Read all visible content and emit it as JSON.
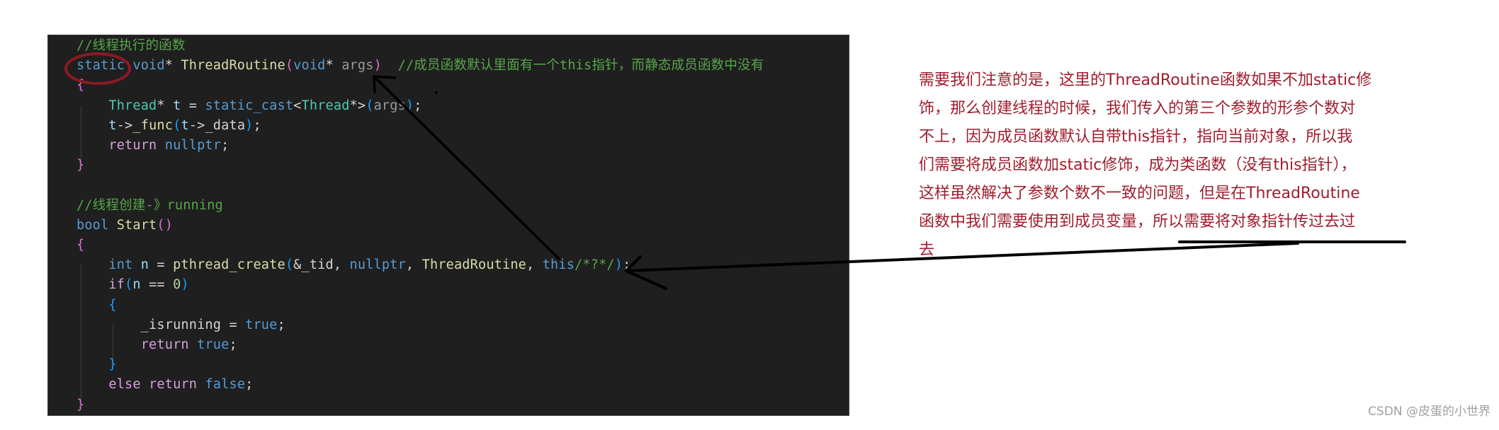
{
  "code": {
    "lines": [
      {
        "tokens": [
          {
            "t": "//线程执行的函数",
            "c": "c-comment"
          }
        ]
      },
      {
        "tokens": [
          {
            "t": "static",
            "c": "c-kw"
          },
          {
            "t": " ",
            "c": "c-punc"
          },
          {
            "t": "void",
            "c": "c-kw"
          },
          {
            "t": "* ",
            "c": "c-punc"
          },
          {
            "t": "ThreadRoutine",
            "c": "c-fn"
          },
          {
            "t": "(",
            "c": "c-br1"
          },
          {
            "t": "void",
            "c": "c-kw"
          },
          {
            "t": "* ",
            "c": "c-punc"
          },
          {
            "t": "args",
            "c": "c-param"
          },
          {
            "t": ")",
            "c": "c-br1"
          },
          {
            "t": "  ",
            "c": "c-punc"
          },
          {
            "t": "//成员函数默认里面有一个this指针，而静态成员函数中没有",
            "c": "c-comment"
          }
        ]
      },
      {
        "tokens": [
          {
            "t": "{",
            "c": "c-br1"
          }
        ]
      },
      {
        "tokens": [
          {
            "t": "    ",
            "c": "c-punc"
          },
          {
            "t": "Thread",
            "c": "c-type"
          },
          {
            "t": "* ",
            "c": "c-punc"
          },
          {
            "t": "t",
            "c": "c-var"
          },
          {
            "t": " = ",
            "c": "c-punc"
          },
          {
            "t": "static_cast",
            "c": "c-kw"
          },
          {
            "t": "<",
            "c": "c-punc"
          },
          {
            "t": "Thread",
            "c": "c-type"
          },
          {
            "t": "*>",
            "c": "c-punc"
          },
          {
            "t": "(",
            "c": "c-br2"
          },
          {
            "t": "args",
            "c": "c-param"
          },
          {
            "t": ")",
            "c": "c-br2"
          },
          {
            "t": ";",
            "c": "c-punc"
          }
        ]
      },
      {
        "tokens": [
          {
            "t": "    ",
            "c": "c-punc"
          },
          {
            "t": "t",
            "c": "c-var"
          },
          {
            "t": "->",
            "c": "c-punc"
          },
          {
            "t": "_func",
            "c": "c-fn"
          },
          {
            "t": "(",
            "c": "c-br2"
          },
          {
            "t": "t",
            "c": "c-var"
          },
          {
            "t": "->",
            "c": "c-punc"
          },
          {
            "t": "_data",
            "c": "c-punc"
          },
          {
            "t": ")",
            "c": "c-br2"
          },
          {
            "t": ";",
            "c": "c-punc"
          }
        ]
      },
      {
        "tokens": [
          {
            "t": "    ",
            "c": "c-punc"
          },
          {
            "t": "return",
            "c": "c-ctrl"
          },
          {
            "t": " ",
            "c": "c-punc"
          },
          {
            "t": "nullptr",
            "c": "c-kw"
          },
          {
            "t": ";",
            "c": "c-punc"
          }
        ]
      },
      {
        "tokens": [
          {
            "t": "}",
            "c": "c-br1"
          }
        ]
      },
      {
        "tokens": []
      },
      {
        "tokens": [
          {
            "t": "//线程创建-》running",
            "c": "c-comment"
          }
        ]
      },
      {
        "tokens": [
          {
            "t": "bool",
            "c": "c-kw"
          },
          {
            "t": " ",
            "c": "c-punc"
          },
          {
            "t": "Start",
            "c": "c-fn"
          },
          {
            "t": "()",
            "c": "c-br1"
          }
        ]
      },
      {
        "tokens": [
          {
            "t": "{",
            "c": "c-br1"
          }
        ]
      },
      {
        "tokens": [
          {
            "t": "    ",
            "c": "c-punc"
          },
          {
            "t": "int",
            "c": "c-kw"
          },
          {
            "t": " ",
            "c": "c-punc"
          },
          {
            "t": "n",
            "c": "c-var"
          },
          {
            "t": " = ",
            "c": "c-punc"
          },
          {
            "t": "pthread_create",
            "c": "c-fn"
          },
          {
            "t": "(",
            "c": "c-br2"
          },
          {
            "t": "&_tid",
            "c": "c-punc"
          },
          {
            "t": ", ",
            "c": "c-punc"
          },
          {
            "t": "nullptr",
            "c": "c-kw"
          },
          {
            "t": ", ",
            "c": "c-punc"
          },
          {
            "t": "ThreadRoutine",
            "c": "c-fn"
          },
          {
            "t": ", ",
            "c": "c-punc"
          },
          {
            "t": "this",
            "c": "c-kw"
          },
          {
            "t": "/*?*/",
            "c": "c-comment"
          },
          {
            "t": ")",
            "c": "c-br2"
          },
          {
            "t": ";",
            "c": "c-punc"
          }
        ]
      },
      {
        "tokens": [
          {
            "t": "    ",
            "c": "c-punc"
          },
          {
            "t": "if",
            "c": "c-ctrl"
          },
          {
            "t": "(",
            "c": "c-br2"
          },
          {
            "t": "n",
            "c": "c-var"
          },
          {
            "t": " == ",
            "c": "c-punc"
          },
          {
            "t": "0",
            "c": "c-num"
          },
          {
            "t": ")",
            "c": "c-br2"
          }
        ]
      },
      {
        "tokens": [
          {
            "t": "    ",
            "c": "c-punc"
          },
          {
            "t": "{",
            "c": "c-br2"
          }
        ]
      },
      {
        "tokens": [
          {
            "t": "        ",
            "c": "c-punc"
          },
          {
            "t": "_isrunning",
            "c": "c-punc"
          },
          {
            "t": " = ",
            "c": "c-punc"
          },
          {
            "t": "true",
            "c": "c-kw"
          },
          {
            "t": ";",
            "c": "c-punc"
          }
        ]
      },
      {
        "tokens": [
          {
            "t": "        ",
            "c": "c-punc"
          },
          {
            "t": "return",
            "c": "c-ctrl"
          },
          {
            "t": " ",
            "c": "c-punc"
          },
          {
            "t": "true",
            "c": "c-kw"
          },
          {
            "t": ";",
            "c": "c-punc"
          }
        ]
      },
      {
        "tokens": [
          {
            "t": "    ",
            "c": "c-punc"
          },
          {
            "t": "}",
            "c": "c-br2"
          }
        ]
      },
      {
        "tokens": [
          {
            "t": "    ",
            "c": "c-punc"
          },
          {
            "t": "else",
            "c": "c-ctrl"
          },
          {
            "t": " ",
            "c": "c-punc"
          },
          {
            "t": "return",
            "c": "c-ctrl"
          },
          {
            "t": " ",
            "c": "c-punc"
          },
          {
            "t": "false",
            "c": "c-kw"
          },
          {
            "t": ";",
            "c": "c-punc"
          }
        ]
      },
      {
        "tokens": [
          {
            "t": "}",
            "c": "c-br1"
          }
        ]
      }
    ]
  },
  "annotation": {
    "lines": [
      "需要我们注意的是，这里的ThreadRoutine函数如果不加static修",
      "饰，那么创建线程的时候，我们传入的第三个参数的形参个数对",
      "不上，因为成员函数默认自带this指针，指向当前对象，所以我",
      "们需要将成员函数加static修饰，成为类函数（没有this指针），",
      "这样虽然解决了参数个数不一致的问题，但是在ThreadRoutine",
      "函数中我们需要使用到成员变量，所以需要将对象指针传过去过",
      "去"
    ],
    "color": "#a01d2e"
  },
  "markup": {
    "circle_color": "#8b1a24",
    "arrow_color": "#000000"
  },
  "watermark": "CSDN @皮蛋的小世界"
}
